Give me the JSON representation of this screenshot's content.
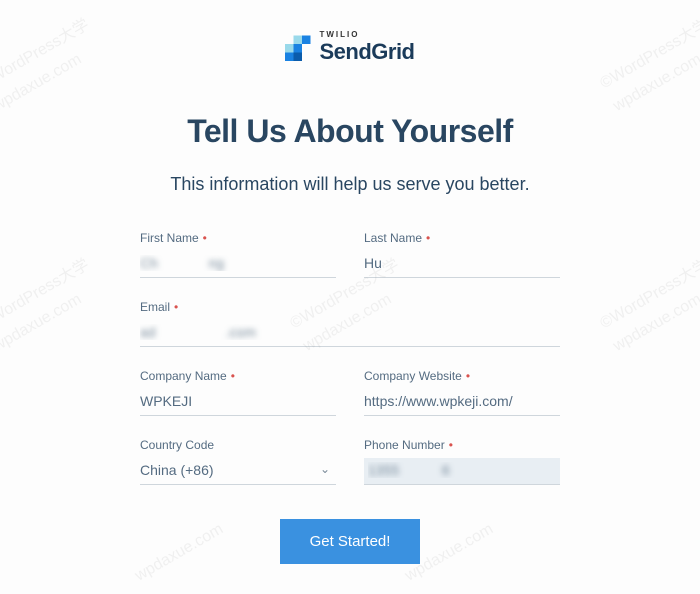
{
  "logo": {
    "twilio": "TWILIO",
    "brand": "SendGrid"
  },
  "heading": "Tell Us About Yourself",
  "subheading": "This information will help us serve you better.",
  "fields": {
    "first_name": {
      "label": "First Name",
      "value": "Ch             ng",
      "required": true
    },
    "last_name": {
      "label": "Last Name",
      "value": "Hu",
      "required": true
    },
    "email": {
      "label": "Email",
      "value": "ad                  .com",
      "required": true
    },
    "company_name": {
      "label": "Company Name",
      "value": "WPKEJI",
      "required": true
    },
    "company_website": {
      "label": "Company Website",
      "value": "https://www.wpkeji.com/",
      "required": true
    },
    "country_code": {
      "label": "Country Code",
      "value": "China (+86)",
      "required": false
    },
    "phone_number": {
      "label": "Phone Number",
      "value": "1355           6",
      "required": true
    }
  },
  "required_marker": "•",
  "buttons": {
    "submit": "Get Started!"
  },
  "watermark": {
    "line1": "©WordPress大学",
    "line2": "wpdaxue.com"
  }
}
